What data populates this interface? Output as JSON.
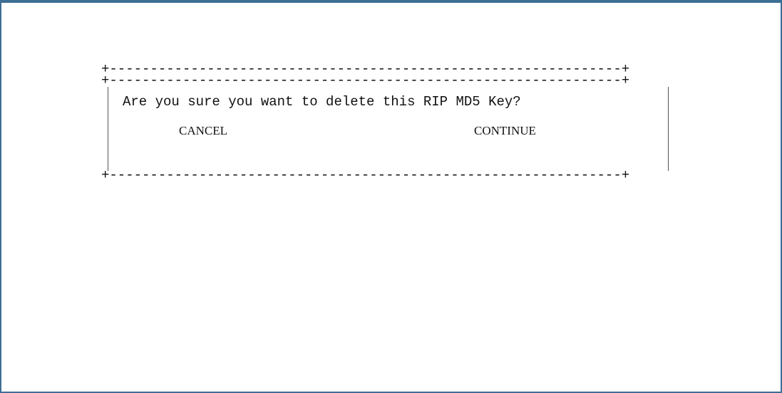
{
  "dialog": {
    "border_top": "+---------------------------------------------------------------+",
    "border_inner": "+---------------------------------------------------------------+",
    "border_bottom": "+---------------------------------------------------------------+",
    "message": "Are you sure you want to delete this RIP MD5 Key?",
    "cancel_label": "CANCEL",
    "continue_label": "CONTINUE"
  },
  "colors": {
    "frame": "#3d6f95",
    "text": "#111111"
  }
}
